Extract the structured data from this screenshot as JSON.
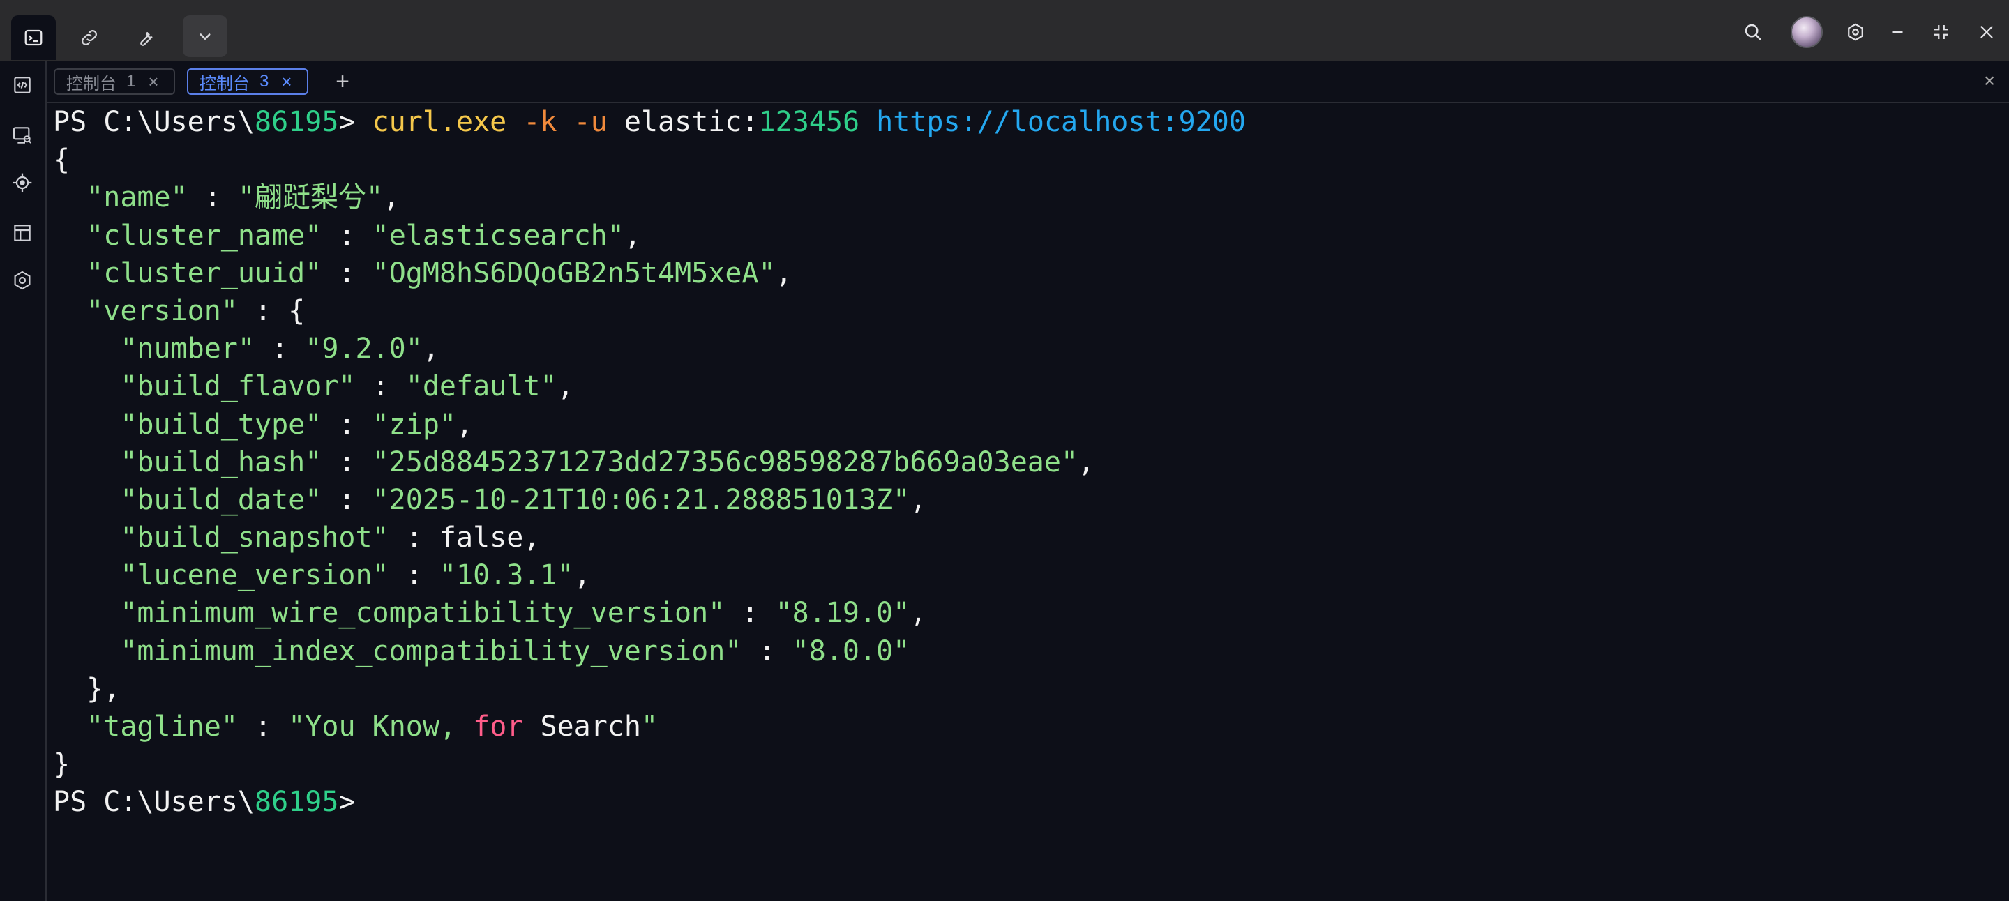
{
  "titlebar": {
    "buttons": [
      "terminal",
      "link",
      "tools",
      "dropdown"
    ],
    "window_controls": [
      "search",
      "avatar",
      "settings",
      "minimize",
      "restore",
      "close"
    ]
  },
  "tabs": [
    {
      "label": "控制台",
      "num": "1",
      "close": "×",
      "active": false
    },
    {
      "label": "控制台",
      "num": "3",
      "close": "×",
      "active": true
    }
  ],
  "add_tab": "+",
  "close_panel": "×",
  "terminal": {
    "prompt_ps": "PS C:\\Users\\",
    "prompt_user": "86195",
    "prompt_gt": ">",
    "cmd_curl": "curl.exe",
    "cmd_k": "-k",
    "cmd_u": "-u",
    "cmd_user": "elastic:",
    "cmd_pass": "123456",
    "cmd_url": "https://localhost:9200",
    "lines": [
      "{",
      "  \"name\" : \"翩跹梨兮\",",
      "  \"cluster_name\" : \"elasticsearch\",",
      "  \"cluster_uuid\" : \"OgM8hS6DQoGB2n5t4M5xeA\",",
      "  \"version\" : {",
      "    \"number\" : \"9.2.0\",",
      "    \"build_flavor\" : \"default\",",
      "    \"build_type\" : \"zip\",",
      "    \"build_hash\" : \"25d88452371273dd27356c98598287b669a03eae\",",
      "    \"build_date\" : \"2025-10-21T10:06:21.288851013Z\",",
      "    \"build_snapshot\" : false,",
      "    \"lucene_version\" : \"10.3.1\",",
      "    \"minimum_wire_compatibility_version\" : \"8.19.0\",",
      "    \"minimum_index_compatibility_version\" : \"8.0.0\"",
      "  },",
      "  \"tagline\" : \"You Know, for Search\"",
      "}"
    ]
  },
  "colors": {
    "background": "#0d0f18",
    "prompt_user": "#2fd08a",
    "command": "#f5c84b",
    "flag": "#f08a3c",
    "url": "#24a8f0",
    "string": "#8fe08a",
    "keyword": "#ff5d8a",
    "active_tab": "#5b8cff"
  }
}
